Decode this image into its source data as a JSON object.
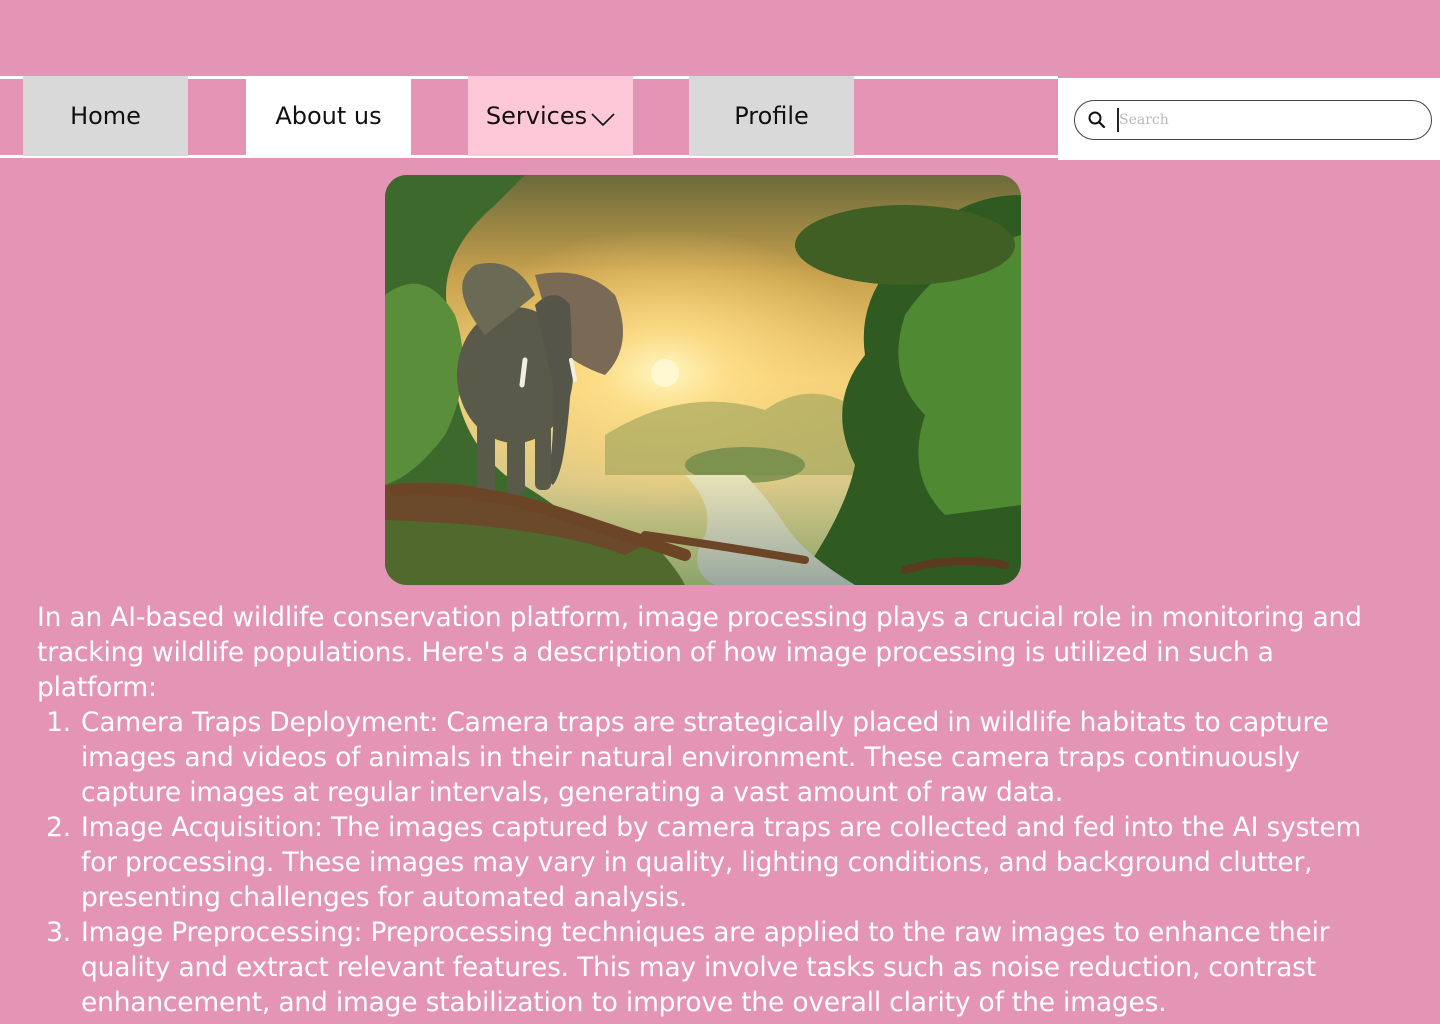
{
  "nav": {
    "items": [
      {
        "label": "Home"
      },
      {
        "label": "About us"
      },
      {
        "label": "Services"
      },
      {
        "label": "Profile"
      }
    ],
    "services_icon": "chevron-down-icon"
  },
  "search": {
    "placeholder": "Search",
    "value": "",
    "icon": "search-icon"
  },
  "hero": {
    "description_icon": "elephant-landscape-image"
  },
  "article": {
    "intro": "In an AI-based wildlife conservation platform, image processing plays a crucial role in monitoring and tracking wildlife populations. Here's a description of how image processing is utilized in such a platform:",
    "steps": [
      {
        "number": "1.",
        "text": "Camera Traps Deployment: Camera traps are strategically placed in wildlife habitats to capture images and videos of animals in their natural environment. These camera traps continuously capture images at regular intervals, generating a vast amount of raw data."
      },
      {
        "number": "2.",
        "text": "Image Acquisition: The images captured by camera traps are collected and fed into the AI system for processing. These images may vary in quality, lighting conditions, and background clutter, presenting challenges for automated analysis."
      },
      {
        "number": "3.",
        "text": "Image Preprocessing: Preprocessing techniques are applied to the raw images to enhance their quality and extract relevant features. This may involve tasks such as noise reduction, contrast enhancement, and image stabilization to improve the overall clarity of the images."
      }
    ]
  },
  "colors": {
    "background": "#e494b4",
    "nav_home": "#d9d9d9",
    "nav_about": "#ffffff",
    "nav_services": "#ffc8d8",
    "nav_profile": "#d9d9d9",
    "text": "#ffffff"
  }
}
